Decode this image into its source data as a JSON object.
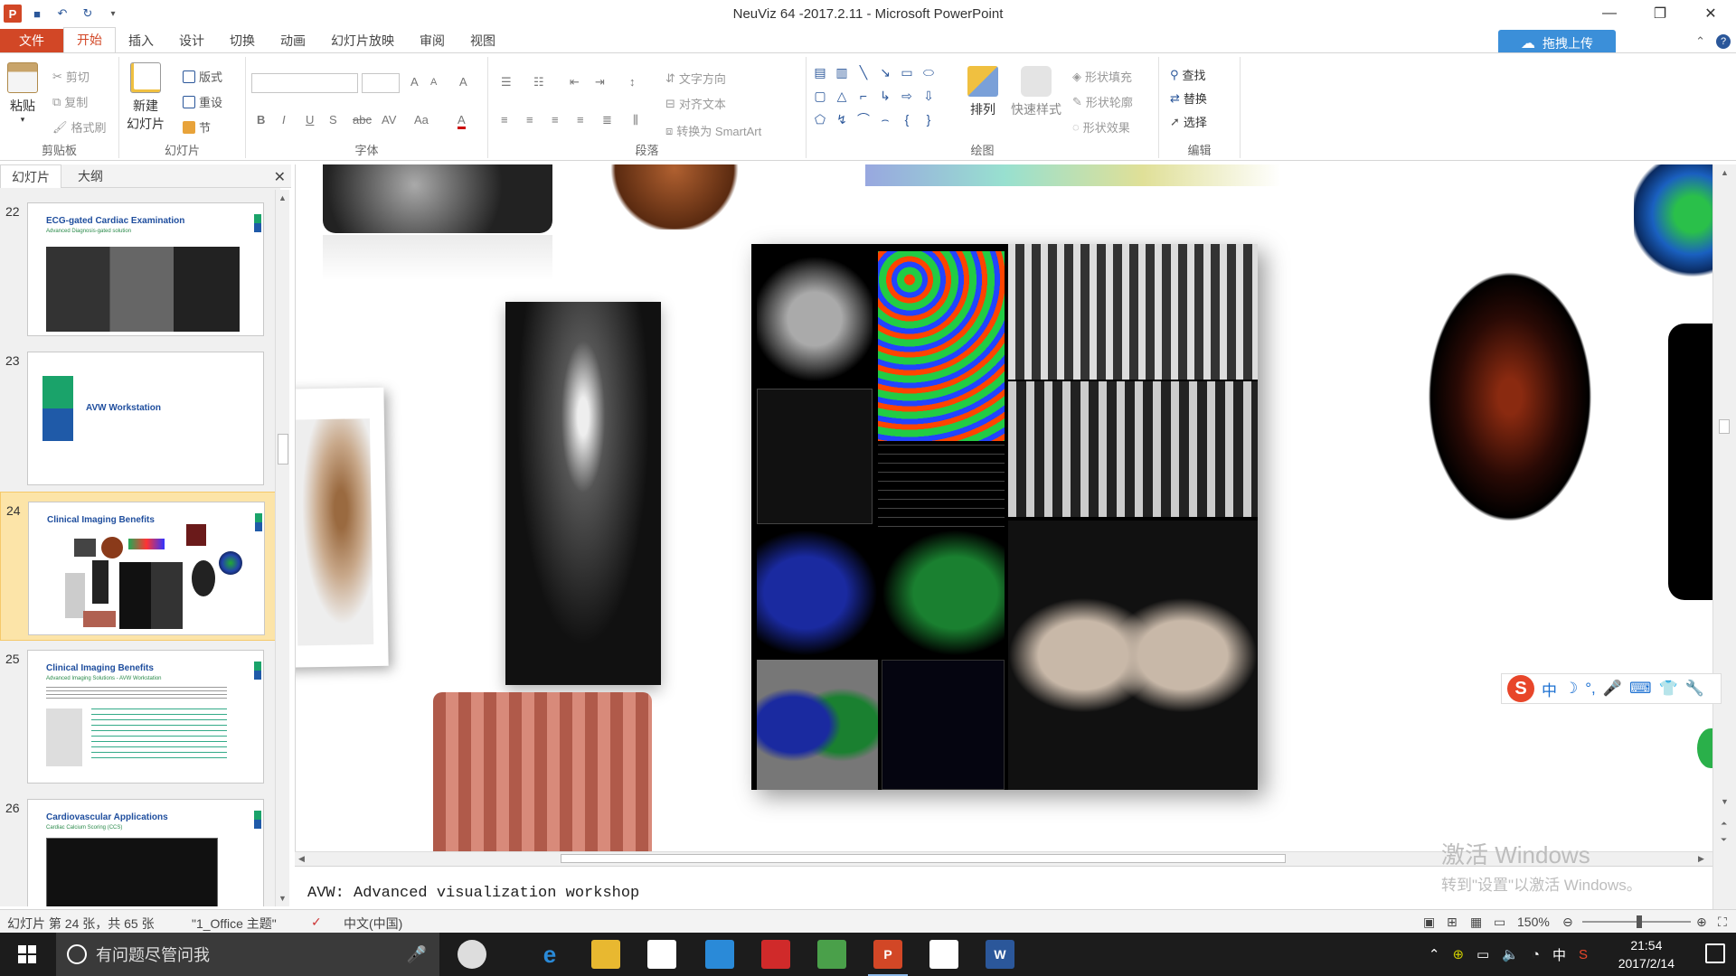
{
  "window": {
    "title": "NeuViz 64 -2017.2.11 - Microsoft PowerPoint",
    "app_logo": "P",
    "controls": [
      "—",
      "❐",
      "✕"
    ]
  },
  "tabs": [
    {
      "label": "文件"
    },
    {
      "label": "开始"
    },
    {
      "label": "插入"
    },
    {
      "label": "设计"
    },
    {
      "label": "切换"
    },
    {
      "label": "动画"
    },
    {
      "label": "幻灯片放映"
    },
    {
      "label": "审阅"
    },
    {
      "label": "视图"
    }
  ],
  "upload_button": "拖拽上传",
  "ribbon": {
    "clipboard": {
      "label": "剪贴板",
      "paste": "粘贴",
      "cut": "剪切",
      "copy": "复制",
      "format_painter": "格式刷"
    },
    "slides": {
      "label": "幻灯片",
      "new_slide_1": "新建",
      "new_slide_2": "幻灯片",
      "layout": "版式",
      "reset": "重设",
      "section": "节"
    },
    "font": {
      "label": "字体",
      "grow": "A",
      "shrink": "A",
      "clear": "A",
      "bold": "B",
      "italic": "I",
      "underline": "U",
      "shadow": "S",
      "strike": "abc",
      "spacing": "AV",
      "case": "Aa",
      "color": "A"
    },
    "paragraph": {
      "label": "段落",
      "text_direction": "文字方向",
      "align_text": "对齐文本",
      "smartart": "转换为 SmartArt"
    },
    "drawing": {
      "label": "绘图",
      "arrange": "排列",
      "quick_styles": "快速样式",
      "shape_fill": "形状填充",
      "shape_outline": "形状轮廓",
      "shape_effects": "形状效果"
    },
    "editing": {
      "label": "编辑",
      "find": "查找",
      "replace": "替换",
      "select": "选择"
    }
  },
  "panel": {
    "tab_slides": "幻灯片",
    "tab_outline": "大纲",
    "close": "✕",
    "thumbnails": [
      {
        "num": "22",
        "title": "ECG-gated Cardiac Examination",
        "sub": "Advanced Diagnosis-gated solution"
      },
      {
        "num": "23",
        "title": "AVW Workstation",
        "sub": ""
      },
      {
        "num": "24",
        "title": "Clinical Imaging Benefits",
        "sub": ""
      },
      {
        "num": "25",
        "title": "Clinical Imaging Benefits",
        "sub": "Advanced Imaging Solutions - AVW Workstation"
      },
      {
        "num": "26",
        "title": "Cardiovascular Applications",
        "sub": "Cardiac Calcium Scoring (CCS)"
      }
    ]
  },
  "notes": "AVW: Advanced visualization workshop",
  "watermark": {
    "line1": "激活 Windows",
    "line2": "转到\"设置\"以激活 Windows。"
  },
  "ime": {
    "logo": "S",
    "mode": "中",
    "items": [
      "☽",
      "°,",
      "🎤",
      "⌨",
      "👕",
      "🔧"
    ]
  },
  "status": {
    "slide_info": "幻灯片 第 24 张，共 65 张",
    "theme": "\"1_Office 主题\"",
    "language": "中文(中国)",
    "zoom": "150%"
  },
  "taskbar": {
    "search_placeholder": "有问题尽管问我",
    "time": "21:54",
    "date": "2017/2/14",
    "ime_tray": "中"
  },
  "colors": {
    "accent": "#d24726",
    "file_tab": "#d24726",
    "upload": "#3b8fd9",
    "taskbar": "#1c1c1c"
  }
}
